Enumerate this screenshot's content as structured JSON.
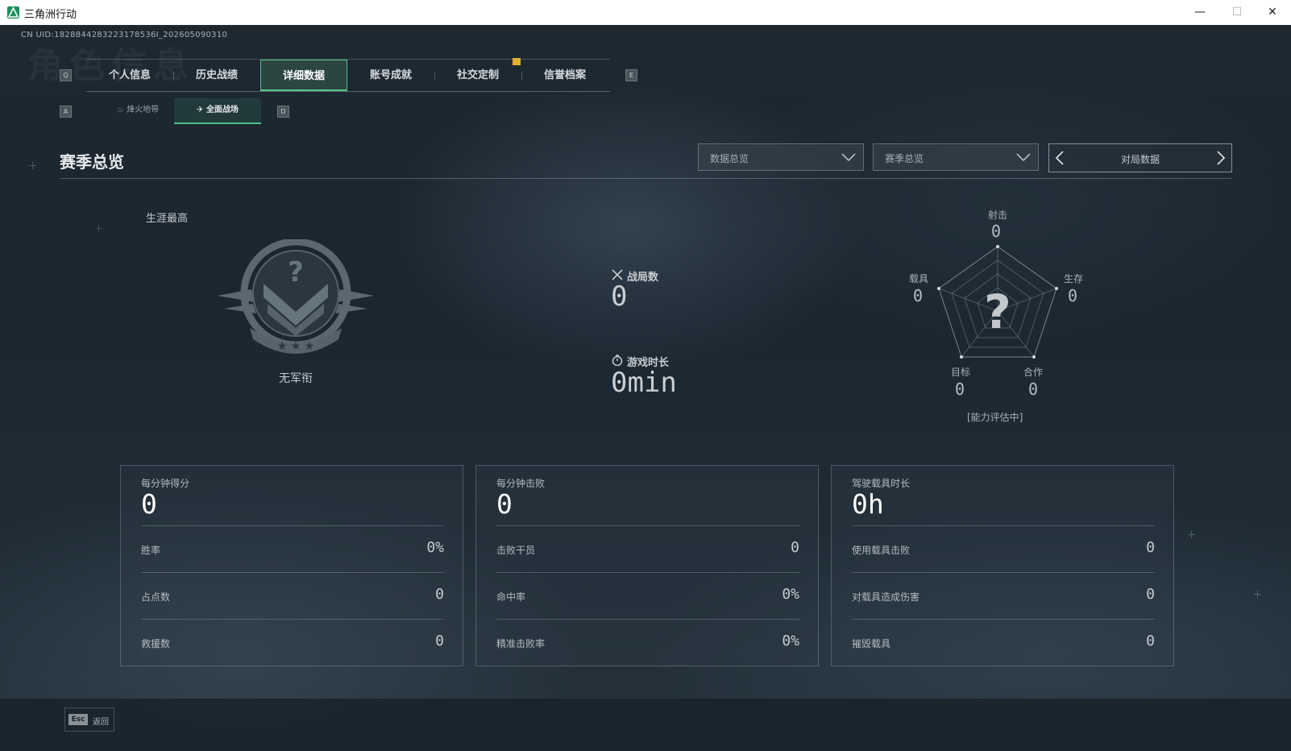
{
  "window": {
    "title": "三角洲行动",
    "minimize": "—",
    "maximize": "☐",
    "close": "✕"
  },
  "uid_text": "CN UID:1828844283223178536I_202605090310",
  "background_text": "角色信息",
  "hints": {
    "prev_tab": "Q",
    "next_tab": "E",
    "prev_sub": "A",
    "next_sub": "D"
  },
  "tabs": [
    {
      "label": "个人信息",
      "active": false
    },
    {
      "label": "历史战绩",
      "active": false
    },
    {
      "label": "详细数据",
      "active": true
    },
    {
      "label": "账号成就",
      "active": false
    },
    {
      "label": "社交定制",
      "active": false
    },
    {
      "label": "信誉档案",
      "active": false
    }
  ],
  "sub_tabs": [
    {
      "label": "烽火地带",
      "active": false,
      "icon": "flame-icon"
    },
    {
      "label": "全面战场",
      "active": true,
      "icon": "battlefield-icon"
    }
  ],
  "section": {
    "title": "赛季总览",
    "dropdown_data": "数据总览",
    "dropdown_season": "赛季总览",
    "pager_label": "对局数据"
  },
  "rank": {
    "career_label": "生涯最高",
    "name": "无军衔"
  },
  "center_stats": {
    "matches_label": "战局数",
    "matches_value": "0",
    "time_label": "游戏时长",
    "time_value": "0min"
  },
  "radar": {
    "center_glyph": "?",
    "status": "[能力评估中]",
    "axes": [
      {
        "label": "射击",
        "value": "0"
      },
      {
        "label": "生存",
        "value": "0"
      },
      {
        "label": "合作",
        "value": "0"
      },
      {
        "label": "目标",
        "value": "0"
      },
      {
        "label": "载具",
        "value": "0"
      }
    ]
  },
  "cards": [
    {
      "head_label": "每分钟得分",
      "head_value": "0",
      "rows": [
        {
          "k": "胜率",
          "v": "0%"
        },
        {
          "k": "占点数",
          "v": "0"
        },
        {
          "k": "救援数",
          "v": "0"
        }
      ]
    },
    {
      "head_label": "每分钟击败",
      "head_value": "0",
      "rows": [
        {
          "k": "击败干员",
          "v": "0"
        },
        {
          "k": "命中率",
          "v": "0%"
        },
        {
          "k": "精准击败率",
          "v": "0%"
        }
      ]
    },
    {
      "head_label": "驾驶载具时长",
      "head_value": "0h",
      "rows": [
        {
          "k": "使用载具击败",
          "v": "0"
        },
        {
          "k": "对载具造成伤害",
          "v": "0"
        },
        {
          "k": "摧毁载具",
          "v": "0"
        }
      ]
    }
  ],
  "footer": {
    "esc_key": "Esc",
    "esc_label": "返回"
  },
  "colors": {
    "accent": "#52c98c",
    "alert": "#e3b12c",
    "background": "#1b2630"
  }
}
